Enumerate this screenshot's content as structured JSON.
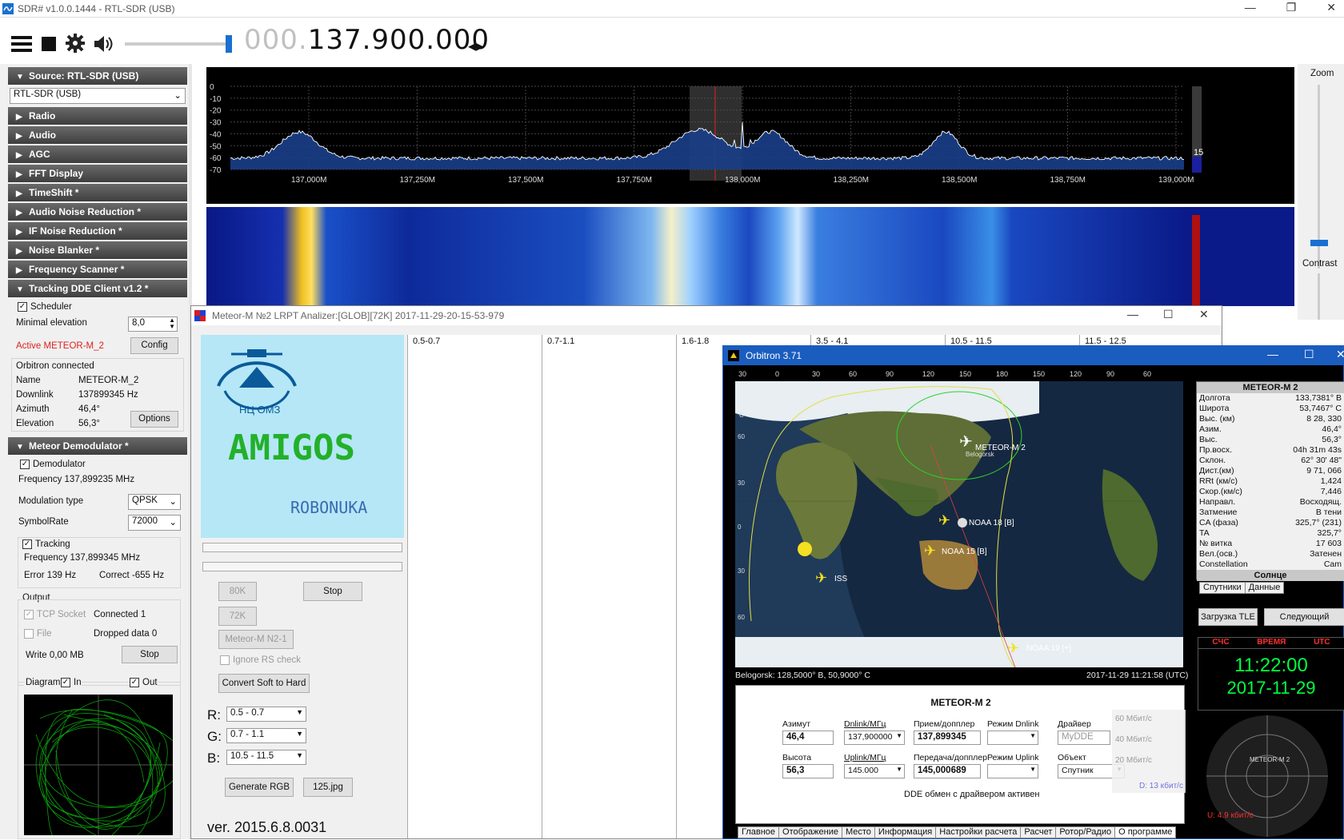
{
  "app": {
    "title": "SDR# v1.0.0.1444 - RTL-SDR (USB)",
    "freq_dim": "000.",
    "freq_main": "137.900.000",
    "source_header": "Source: RTL-SDR (USB)",
    "source_value": "RTL-SDR (USB)"
  },
  "sections": [
    "Radio",
    "Audio",
    "AGC",
    "FFT Display",
    "TimeShift *",
    "Audio Noise Reduction *",
    "IF Noise Reduction *",
    "Noise Blanker *",
    "Frequency Scanner *",
    "Tracking DDE Client v1.2 *"
  ],
  "tracking": {
    "scheduler": "Scheduler",
    "min_elev_label": "Minimal elevation",
    "min_elev_value": "8,0",
    "active": "Active METEOR-M_2",
    "config": "Config",
    "orbitron_connected": "Orbitron connected",
    "rows": [
      {
        "k": "Name",
        "v": "METEOR-M_2"
      },
      {
        "k": "Downlink",
        "v": "137899345 Hz"
      },
      {
        "k": "Azimuth",
        "v": "46,4°"
      },
      {
        "k": "Elevation",
        "v": "56,3°"
      }
    ],
    "options": "Options"
  },
  "demod": {
    "header": "Meteor Demodulator *",
    "demodulator": "Demodulator",
    "frequency": "Frequency 137,899235 MHz",
    "mod_label": "Modulation type",
    "mod_value": "QPSK",
    "sym_label": "SymbolRate",
    "sym_value": "72000",
    "tracking": "Tracking",
    "trk_freq": "Frequency 137,899345 MHz",
    "error": "Error 139 Hz",
    "correct": "Correct -655 Hz",
    "output": "Output",
    "tcp": "TCP Socket",
    "connected": "Connected 1",
    "file": "File",
    "dropped": "Dropped data 0",
    "write": "Write 0,00 MB",
    "stop": "Stop",
    "diagram": "Diagram",
    "in": "In",
    "out": "Out"
  },
  "spectrum": {
    "y_ticks": [
      "0",
      "-10",
      "-20",
      "-30",
      "-40",
      "-50",
      "-60",
      "-70"
    ],
    "x_ticks": [
      "137,000M",
      "137,250M",
      "137,500M",
      "137,750M",
      "138,000M",
      "138,250M",
      "138,500M",
      "138,750M",
      "139,000M"
    ],
    "level": "15"
  },
  "zoom": {
    "zoom": "Zoom",
    "contrast": "Contrast"
  },
  "meteor": {
    "title": "Meteor-M №2 LRPT Analizer:[GLOB][72K] 2017-11-29-20-15-53-979",
    "logo_text": "НЦ ОМЗ",
    "amigos": "AMIGOS",
    "robonuka": "ROBONUKA",
    "btn_80k": "80K",
    "btn_stop": "Stop",
    "btn_72k": "72K",
    "btn_n21": "Meteor-M N2-1",
    "ignore_rs": "Ignore RS check",
    "convert": "Convert Soft to Hard",
    "r_label": "R:",
    "r_val": "0.5 - 0.7",
    "g_label": "G:",
    "g_val": "0.7 - 1.1",
    "b_label": "B:",
    "b_val": "10.5 - 11.5",
    "generate": "Generate RGB",
    "jpg": "125.jpg",
    "version": "ver. 2015.6.8.0031",
    "channels": [
      "0.5-0.7",
      "0.7-1.1",
      "1.6-1.8",
      "3.5 - 4.1",
      "10.5 - 11.5",
      "11.5 - 12.5"
    ]
  },
  "orbitron": {
    "title": "Orbitron 3.71",
    "lon_ticks": [
      "30",
      "0",
      "30",
      "60",
      "90",
      "120",
      "150",
      "180",
      "150",
      "120",
      "90",
      "60"
    ],
    "sats": [
      {
        "name": "METEOR-M 2"
      },
      {
        "name": "NOAA 18 [B]"
      },
      {
        "name": "NOAA 15 [B]"
      },
      {
        "name": "ISS"
      },
      {
        "name": "NOAA 19 [+]"
      }
    ],
    "belogorsk_label": "Belogorsk",
    "location": "Belogorsk: 128,5000° В, 50,9000° С",
    "datetime": "2017-11-29 11:21:58 (UTC)",
    "side_title": "METEOR-M 2",
    "side_rows": [
      {
        "k": "Долгота",
        "v": "133,7381° В"
      },
      {
        "k": "Широта",
        "v": "53,7467° С"
      },
      {
        "k": "Выс. (км)",
        "v": "8 28, 330"
      },
      {
        "k": "Азим.",
        "v": "46,4°"
      },
      {
        "k": "Выс.",
        "v": "56,3°"
      },
      {
        "k": "Пр.восх.",
        "v": "04h 31m 43s"
      },
      {
        "k": "Склон.",
        "v": "62° 30' 48\""
      },
      {
        "k": "Дист.(км)",
        "v": "9 71, 066"
      },
      {
        "k": "RRt (км/с)",
        "v": "1,424"
      },
      {
        "k": "Скор.(км/с)",
        "v": "7,446"
      },
      {
        "k": "Направл.",
        "v": "Восходящ."
      },
      {
        "k": "Затмение",
        "v": "В тени"
      },
      {
        "k": "CA (фаза)",
        "v": "325,7° (231)"
      },
      {
        "k": "TA",
        "v": "325,7°"
      },
      {
        "k": "№ витка",
        "v": "17 603"
      },
      {
        "k": "Вел.(осв.)",
        "v": "Затенен"
      },
      {
        "k": "Constellation",
        "v": "Cam"
      }
    ],
    "sun": "Солнце",
    "tab_sats": "Спутники",
    "tab_data": "Данные",
    "btn_tle": "Загрузка TLE",
    "btn_next": "Следующий",
    "clock_hdr": [
      "СЧС",
      "ВРЕМЯ",
      "UTC"
    ],
    "clock_time": "11:22:00",
    "clock_date": "2017-11-29",
    "panel_title": "METEOR-M 2",
    "az_label": "Азимут",
    "az_val": "46,4",
    "dn_label": "Dnlink/МГц",
    "dn_val": "137,900000",
    "rx_label": "Прием/допплер",
    "rx_val": "137,899345",
    "mdn_label": "Режим Dnlink",
    "drv_label": "Драйвер",
    "drv_val": "MyDDE",
    "el_label": "Высота",
    "el_val": "56,3",
    "up_label": "Uplink/МГц",
    "up_val": "145.000",
    "tx_label": "Передача/допплер",
    "tx_val": "145,000689",
    "mup_label": "Режим Uplink",
    "obj_label": "Объект",
    "obj_val": "Спутник",
    "dde_status": "DDE обмен с драйвером активен",
    "tabs": [
      "Главное",
      "Отображение",
      "Место",
      "Информация",
      "Настройки расчета",
      "Расчет",
      "Ротор/Радио",
      "О программе"
    ],
    "net": {
      "s60": "60 Мбит/с",
      "s40": "40 Мбит/с",
      "s20": "20 Мбит/с",
      "d": "D: 13 кбит/с",
      "u": "U: 4.9 кбит/с"
    },
    "radar_label": "METEOR-M 2"
  },
  "colors": {
    "accent": "#1a5dbf",
    "green_trace": "#00c800",
    "clock": "#00ff40"
  }
}
